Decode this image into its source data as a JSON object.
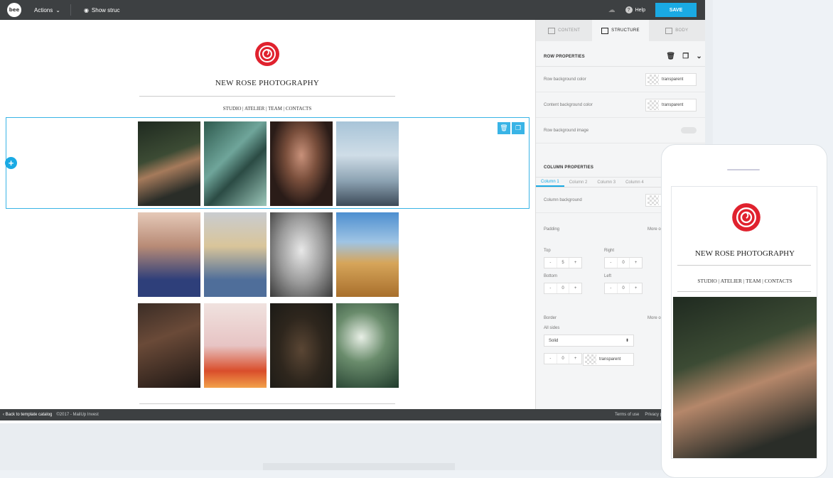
{
  "topbar": {
    "logo": "bee",
    "actions_label": "Actions",
    "show_structure_label": "Show struc",
    "help_label": "Help",
    "save_label": "SAVE"
  },
  "email": {
    "brand_title": "NEW ROSE PHOTOGRAPHY",
    "nav_links": "STUDIO  |  ATELIER  |  TEAM  |  CONTACTS",
    "brand_color": "#e0222e"
  },
  "panel": {
    "tabs": [
      {
        "label": "CONTENT",
        "icon": "grid-icon"
      },
      {
        "label": "STRUCTURE",
        "icon": "rows-icon"
      },
      {
        "label": "BODY",
        "icon": "body-icon"
      }
    ],
    "row_properties": {
      "title": "ROW PROPERTIES",
      "row_bg_label": "Row background color",
      "row_bg_value": "transparent",
      "content_bg_label": "Content background color",
      "content_bg_value": "transparent",
      "row_bg_image_label": "Row background image"
    },
    "column_properties": {
      "title": "COLUMN PROPERTIES",
      "tabs": [
        "Column 1",
        "Column 2",
        "Column 3",
        "Column 4"
      ],
      "column_bg_label": "Column background",
      "padding_label": "Padding",
      "more_options": "More o",
      "top_label": "Top",
      "right_label": "Right",
      "bottom_label": "Bottom",
      "left_label": "Left",
      "top_value": "5",
      "right_value": "0",
      "bottom_value": "0",
      "left_value": "0",
      "border_label": "Border",
      "border_more": "More o",
      "all_sides_label": "All sides",
      "border_style": "Solid",
      "border_width": "0",
      "border_color": "transparent"
    }
  },
  "footer": {
    "back_label": "Back to template catalog",
    "copyright": "©2017 - MailUp Invest",
    "terms": "Terms of use",
    "privacy": "Privacy p"
  },
  "phone": {
    "brand_title": "NEW ROSE PHOTOGRAPHY",
    "nav_links": "STUDIO  |  ATELIER  |  TEAM  |  CONTACTS"
  }
}
